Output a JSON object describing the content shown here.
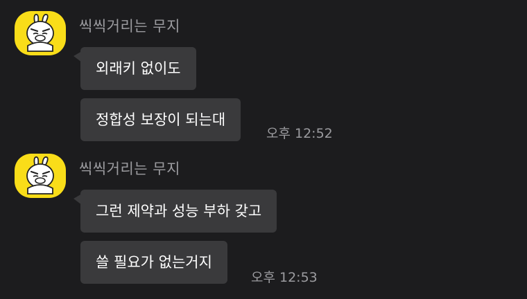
{
  "messages": [
    {
      "sender": "씩씩거리는 무지",
      "avatar_icon": "muzi-avatar-icon",
      "bubbles": [
        "외래키 없이도",
        "정합성 보장이 되는대"
      ],
      "time": "오후 12:52"
    },
    {
      "sender": "씩씩거리는 무지",
      "avatar_icon": "muzi-avatar-icon",
      "bubbles": [
        "그런 제약과 성능 부하 갖고",
        "쓸 필요가 없는거지"
      ],
      "time": "오후 12:53"
    }
  ],
  "colors": {
    "background": "#1c1c1e",
    "bubble": "#3a3a3c",
    "avatar": "#f9dd19",
    "meta_text": "#9c9ca0"
  }
}
